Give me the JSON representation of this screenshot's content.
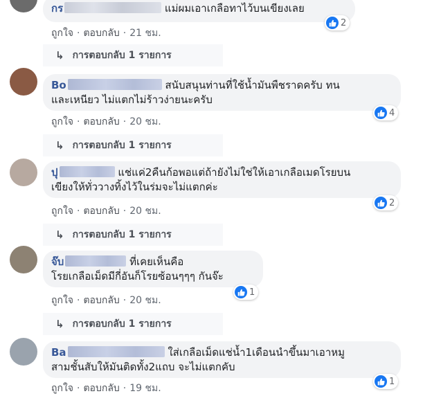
{
  "comments": [
    {
      "author_visible": "กร",
      "text": "แม่ผมเอาเกลือทาไว้บนเขียงเลย",
      "line2": "",
      "reaction_count": "2",
      "like_label": "ถูกใจ",
      "reply_label": "ตอบกลับ",
      "time": "21 ชม.",
      "replies_label": "การตอบกลับ 1 รายการ"
    },
    {
      "author_visible": "Bo",
      "text": "สนับสนุนท่านที่ใช้น้ำมันพืชราดครับ ทน",
      "line2": "และเหนียว ไม่แตกไม่ร้าวง่ายนะครับ",
      "reaction_count": "4",
      "like_label": "ถูกใจ",
      "reply_label": "ตอบกลับ",
      "time": "20 ชม.",
      "replies_label": "การตอบกลับ 1 รายการ"
    },
    {
      "author_visible": "ปุ",
      "text": "แช่แค่2คืนก้อพอแต่ถ้ายังไม่ใช่ให้เอาเกลือเมดโรยบน",
      "line2": "เขียงให้ทั่ววางทิ้งไว้ในร่มจะไม่แตกค่ะ",
      "reaction_count": "2",
      "like_label": "ถูกใจ",
      "reply_label": "ตอบกลับ",
      "time": "20 ชม.",
      "replies_label": "การตอบกลับ 1 รายการ"
    },
    {
      "author_visible": "จ๊บ",
      "text": "ที่เคยเห็นคือ",
      "line2": "โรยเกลือเม็ดมีกี่อันก็โรยซ้อนๆๆๆ กันจ๊ะ",
      "reaction_count": "1",
      "like_label": "ถูกใจ",
      "reply_label": "ตอบกลับ",
      "time": "20 ชม.",
      "replies_label": "การตอบกลับ 1 รายการ"
    },
    {
      "author_visible": "Ba",
      "text": "ใส่เกลือเม็ดแช่น้ำ1เดือนนำขึ้นมาเอาหมู",
      "line2": "สามชั้นสับให้มันติดทั้ง2แถบ จะไม่แตกคับ",
      "reaction_count": "1",
      "like_label": "ถูกใจ",
      "reply_label": "ตอบกลับ",
      "time": "19 ชม.",
      "replies_label": ""
    }
  ],
  "icons": {
    "like": "thumbs-up-icon",
    "reply_arrow": "reply-arrow-icon"
  },
  "colors": {
    "accent": "#1877f2",
    "author": "#385898",
    "bubble": "#f2f3f5"
  }
}
